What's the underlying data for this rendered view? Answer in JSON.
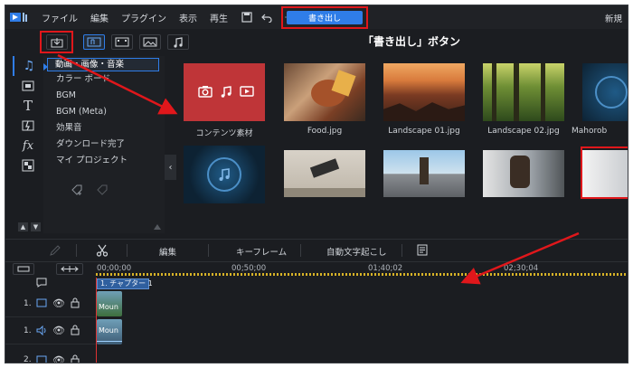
{
  "menubar": {
    "items": [
      "ファイル",
      "編集",
      "プラグイン",
      "表示",
      "再生"
    ],
    "export_label": "書き出し",
    "new_label": "新規"
  },
  "annotation": {
    "callout_text": "「書き出し」ボタン"
  },
  "categories": [
    "動画・画像・音楽",
    "カラー ボード",
    "BGM",
    "BGM (Meta)",
    "効果音",
    "ダウンロード完了",
    "マイ プロジェクト"
  ],
  "media": {
    "row1": [
      {
        "label": "コンテンツ素材",
        "icon": "content-icon"
      },
      {
        "label": "Food.jpg"
      },
      {
        "label": "Landscape 01.jpg"
      },
      {
        "label": "Landscape 02.jpg"
      },
      {
        "label": "Mahorob"
      }
    ]
  },
  "edit_toolbar": {
    "edit": "編集",
    "keyframe": "キーフレーム",
    "auto_caption": "自動文字起こし"
  },
  "timeline": {
    "ticks": [
      "00;00;00",
      "00;50;00",
      "01;40;02",
      "02;30;04"
    ],
    "chapter": "1. チャプター 1",
    "track1": "1.",
    "track2": "1.",
    "track3": "2.",
    "clip_label": "Moun"
  },
  "colors": {
    "accent": "#2f7de8",
    "highlight_red": "#e0171b",
    "content_tile": "#c0373a"
  }
}
